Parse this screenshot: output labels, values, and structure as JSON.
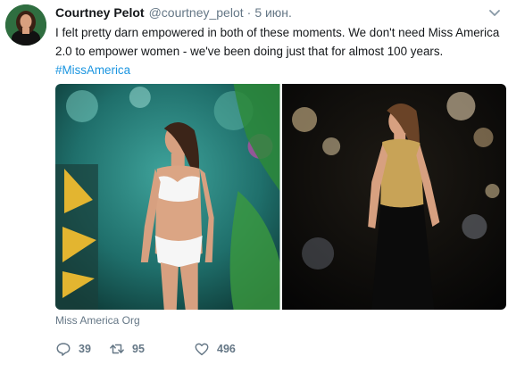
{
  "tweet": {
    "author_name": "Courtney Pelot",
    "author_handle": "@courtney_pelot",
    "separator": "·",
    "timestamp": "5 июн.",
    "text_before": "I felt pretty darn empowered in both of these moments. We don't need Miss America 2.0 to empower women - we've been doing just that for almost 100 years. ",
    "hashtag": "#MissAmerica",
    "media_source": "Miss America Org",
    "counts": {
      "replies": "39",
      "retweets": "95",
      "likes": "496"
    }
  },
  "colors": {
    "text": "#14171a",
    "muted": "#657786",
    "link": "#1b95e0"
  },
  "icons": {
    "caret": "chevron-down-icon",
    "reply": "reply-icon",
    "retweet": "retweet-icon",
    "like": "heart-icon"
  }
}
